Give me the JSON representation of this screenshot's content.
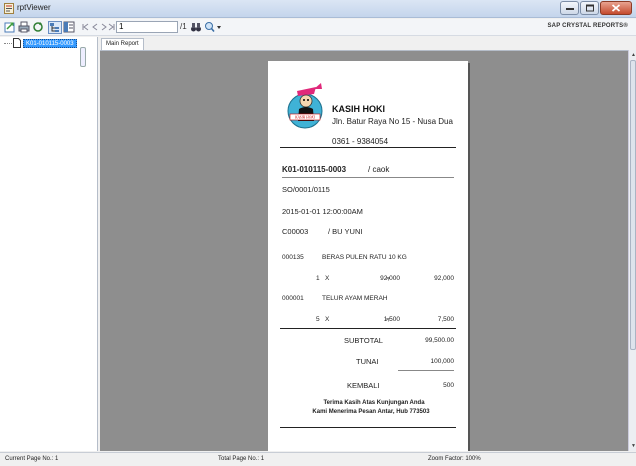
{
  "window": {
    "title": "rptViewer"
  },
  "toolbar": {
    "current_page_value": "1",
    "page_count": "/1",
    "brand": "SAP CRYSTAL REPORTS®"
  },
  "tree": {
    "item": "K01-010115-0003"
  },
  "tabs": [
    {
      "label": "Main Report"
    }
  ],
  "receipt": {
    "shop_name": "KASIH HOKI",
    "address": "Jln. Batur Raya No 15 - Nusa Dua",
    "phone": "0361 - 9384054",
    "invoice_no": "K01-010115-0003",
    "cashier": "/ caok",
    "so_no": "SO/0001/0115",
    "datetime": "2015-01-01  12:00:00AM",
    "customer_code": "C00003",
    "customer_name": "/ BU YUNI",
    "items": [
      {
        "code": "000135",
        "name": "BERAS PULEN RATU 10 KG",
        "qty": "1",
        "x": "X",
        "price": "92,000",
        "eq": "=",
        "total": "92,000"
      },
      {
        "code": "000001",
        "name": "TELUR AYAM MERAH",
        "qty": "5",
        "x": "X",
        "price": "1,500",
        "eq": "=",
        "total": "7,500"
      }
    ],
    "subtotal_label": "SUBTOTAL",
    "subtotal_value": "99,500.00",
    "tunai_label": "TUNAI",
    "tunai_value": "100,000",
    "kembali_label": "KEMBALI",
    "kembali_value": "500",
    "thanks_line1": "Terima Kasih Atas Kunjungan Anda",
    "thanks_line2": "Kami Menerima Pesan Antar, Hub  773503",
    "logo_text": "KASIH HOKI"
  },
  "status": {
    "current_page": "Current Page No.: 1",
    "total_page": "Total Page No.: 1",
    "zoom": "Zoom Factor: 100%"
  }
}
